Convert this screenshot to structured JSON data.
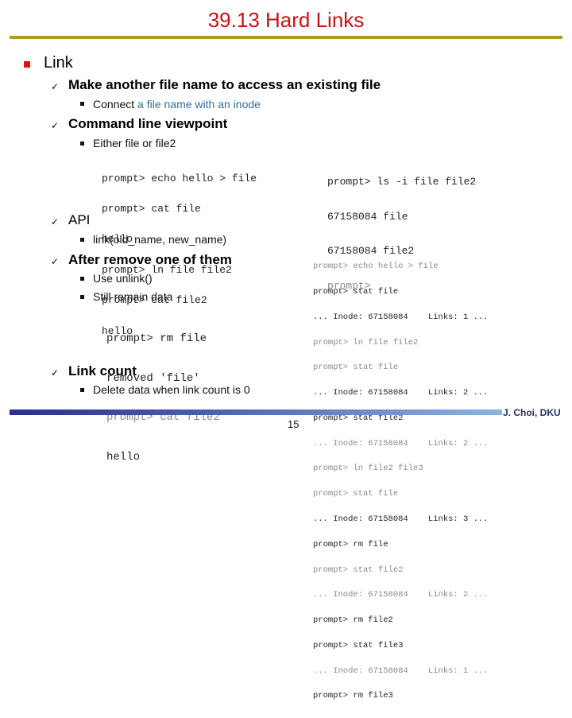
{
  "slide": {
    "title": "39.13 Hard Links",
    "page_number": "15",
    "author": "J. Choi, DKU",
    "colors": {
      "title": "#cc1111",
      "rule": "#b8971f",
      "bullet": "#e01010",
      "accent_text": "#2f6fa6"
    }
  },
  "outline": {
    "heading": "Link",
    "items": [
      {
        "label": "Make another file name to access an existing file",
        "sub": [
          {
            "prefix": "Connect ",
            "accent": "a file name with an inode"
          }
        ]
      },
      {
        "label": "Command line viewpoint",
        "sub": [
          {
            "text": "Either file or file2"
          }
        ]
      },
      {
        "label": "API",
        "sub": [
          {
            "text": "link(old_name, new_name)"
          }
        ]
      },
      {
        "label": "After remove one of them",
        "sub": [
          {
            "text": "Use unlink()"
          },
          {
            "text": "Still remain data"
          }
        ]
      },
      {
        "label": "Link count",
        "sub": [
          {
            "text": "Delete data when link count is 0"
          }
        ]
      }
    ]
  },
  "terminals": {
    "create_link": [
      "prompt> echo hello > file",
      "prompt> cat file",
      "hello",
      "prompt> ln file file2",
      "prompt> cat file2",
      "hello"
    ],
    "ls_inode": [
      "prompt> ls -i file file2",
      "67158084 file",
      "67158084 file2",
      "prompt>"
    ],
    "remove_file": [
      "prompt> rm file",
      "removed 'file'",
      "prompt> cat file2",
      "hello"
    ],
    "link_count": [
      "prompt> echo hello > file",
      "prompt> stat file",
      "... Inode: 67158084    Links: 1 ...",
      "prompt> ln file file2",
      "prompt> stat file",
      "... Inode: 67158084    Links: 2 ...",
      "prompt> stat file2",
      "... Inode: 67158084    Links: 2 ...",
      "prompt> ln file2 file3",
      "prompt> stat file",
      "... Inode: 67158084    Links: 3 ...",
      "prompt> rm file",
      "prompt> stat file2",
      "... Inode: 67158084    Links: 2 ...",
      "prompt> rm file2",
      "prompt> stat file3",
      "... Inode: 67158084    Links: 1 ...",
      "prompt> rm file3"
    ]
  }
}
